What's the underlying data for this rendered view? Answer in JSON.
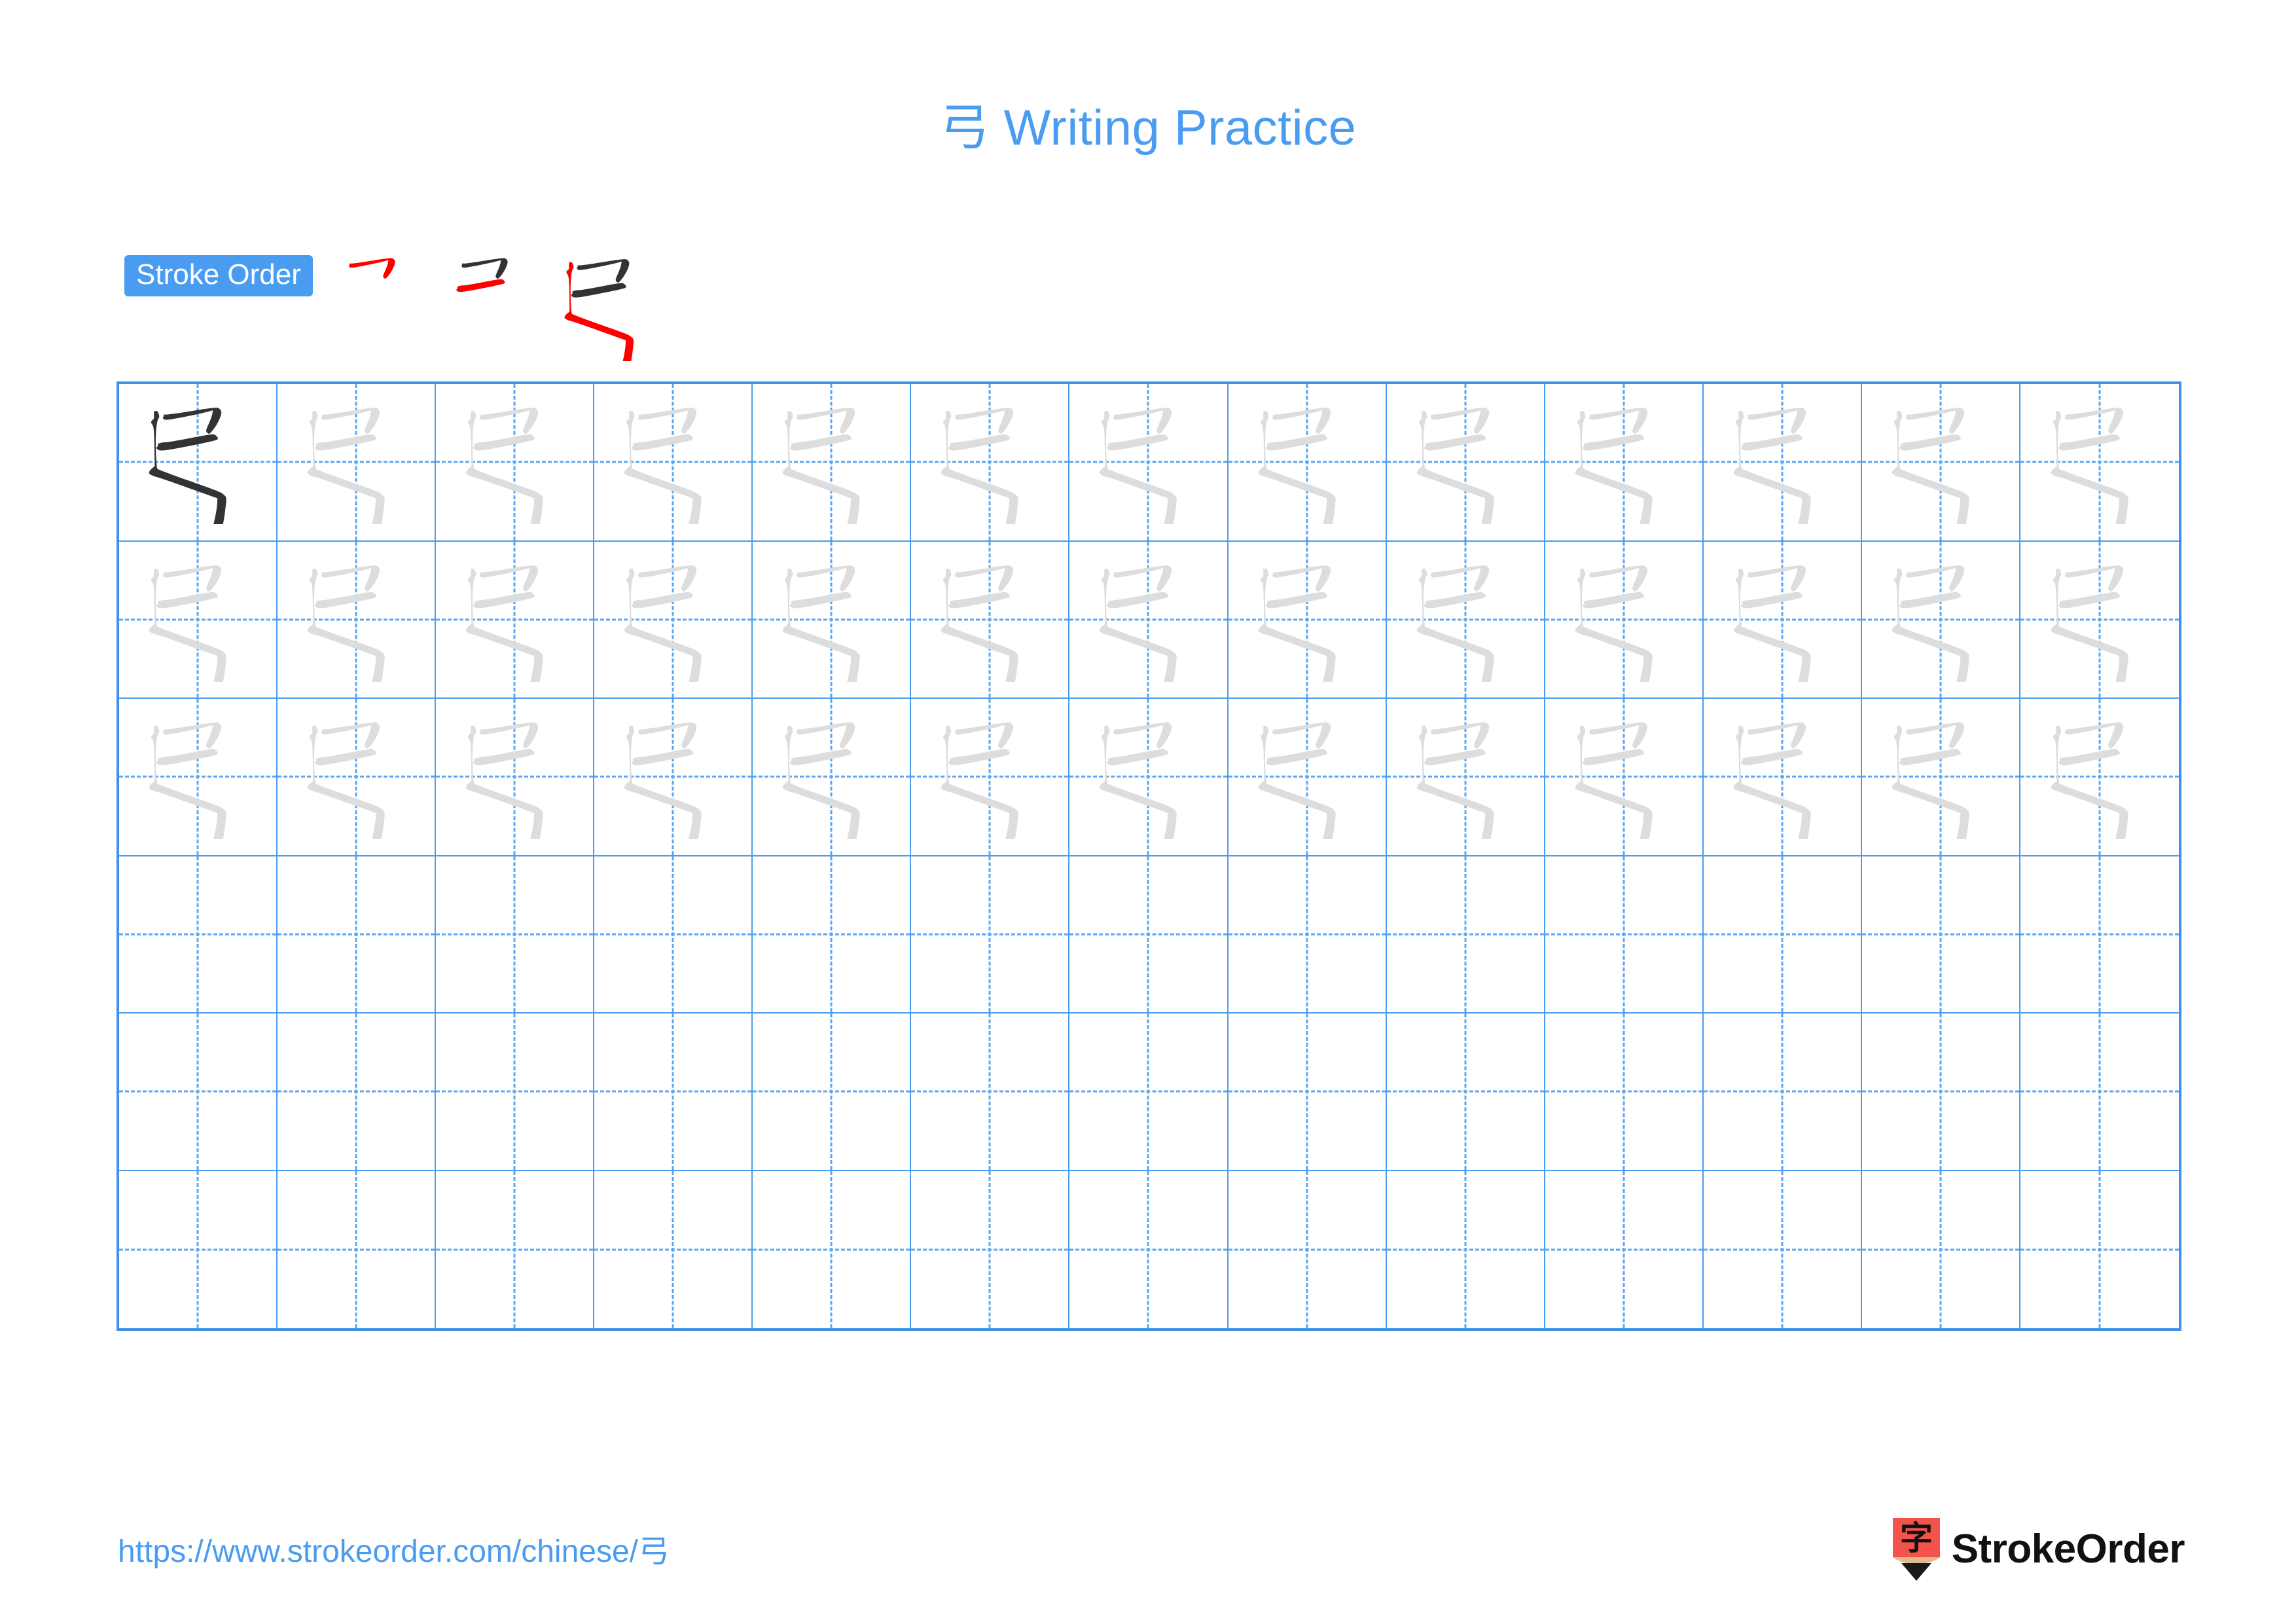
{
  "page": {
    "character": "弓",
    "title": "弓 Writing Practice",
    "title_accent_color": "#4A9CF0",
    "background_color": "#FFFFFF"
  },
  "stroke_order": {
    "badge_label": "Stroke Order",
    "badge_bg_color": "#4A9CF0",
    "badge_text_color": "#FFFFFF",
    "new_stroke_color": "#FF0000",
    "prev_stroke_color": "#333333",
    "total_strokes": 3,
    "steps": [
      {
        "step": 1,
        "strokes_shown": 1,
        "new_stroke_index": 1
      },
      {
        "step": 2,
        "strokes_shown": 2,
        "new_stroke_index": 2
      },
      {
        "step": 3,
        "strokes_shown": 3,
        "new_stroke_index": 3
      }
    ]
  },
  "grid": {
    "columns": 13,
    "rows": 6,
    "line_color": "#4A9CF0",
    "border_color": "#3D93E8",
    "guide_color": "#5AA7F2",
    "solid_glyph_color": "#333333",
    "trace_glyph_color": "#DDDDDD",
    "rows_data": [
      {
        "row": 1,
        "cells": [
          "solid",
          "trace",
          "trace",
          "trace",
          "trace",
          "trace",
          "trace",
          "trace",
          "trace",
          "trace",
          "trace",
          "trace",
          "trace"
        ]
      },
      {
        "row": 2,
        "cells": [
          "trace",
          "trace",
          "trace",
          "trace",
          "trace",
          "trace",
          "trace",
          "trace",
          "trace",
          "trace",
          "trace",
          "trace",
          "trace"
        ]
      },
      {
        "row": 3,
        "cells": [
          "trace",
          "trace",
          "trace",
          "trace",
          "trace",
          "trace",
          "trace",
          "trace",
          "trace",
          "trace",
          "trace",
          "trace",
          "trace"
        ]
      },
      {
        "row": 4,
        "cells": [
          "empty",
          "empty",
          "empty",
          "empty",
          "empty",
          "empty",
          "empty",
          "empty",
          "empty",
          "empty",
          "empty",
          "empty",
          "empty"
        ]
      },
      {
        "row": 5,
        "cells": [
          "empty",
          "empty",
          "empty",
          "empty",
          "empty",
          "empty",
          "empty",
          "empty",
          "empty",
          "empty",
          "empty",
          "empty",
          "empty"
        ]
      },
      {
        "row": 6,
        "cells": [
          "empty",
          "empty",
          "empty",
          "empty",
          "empty",
          "empty",
          "empty",
          "empty",
          "empty",
          "empty",
          "empty",
          "empty",
          "empty"
        ]
      }
    ]
  },
  "footer": {
    "url_text": "https://www.strokeorder.com/chinese/弓",
    "url_color": "#4A9CF0",
    "brand_name": "StrokeOrder",
    "brand_mark_character": "字",
    "brand_mark_bg_color": "#F2534B",
    "brand_mark_tip_color": "#E3B98E",
    "brand_mark_point_color": "#1A1A1A",
    "brand_text_color": "#111111"
  }
}
